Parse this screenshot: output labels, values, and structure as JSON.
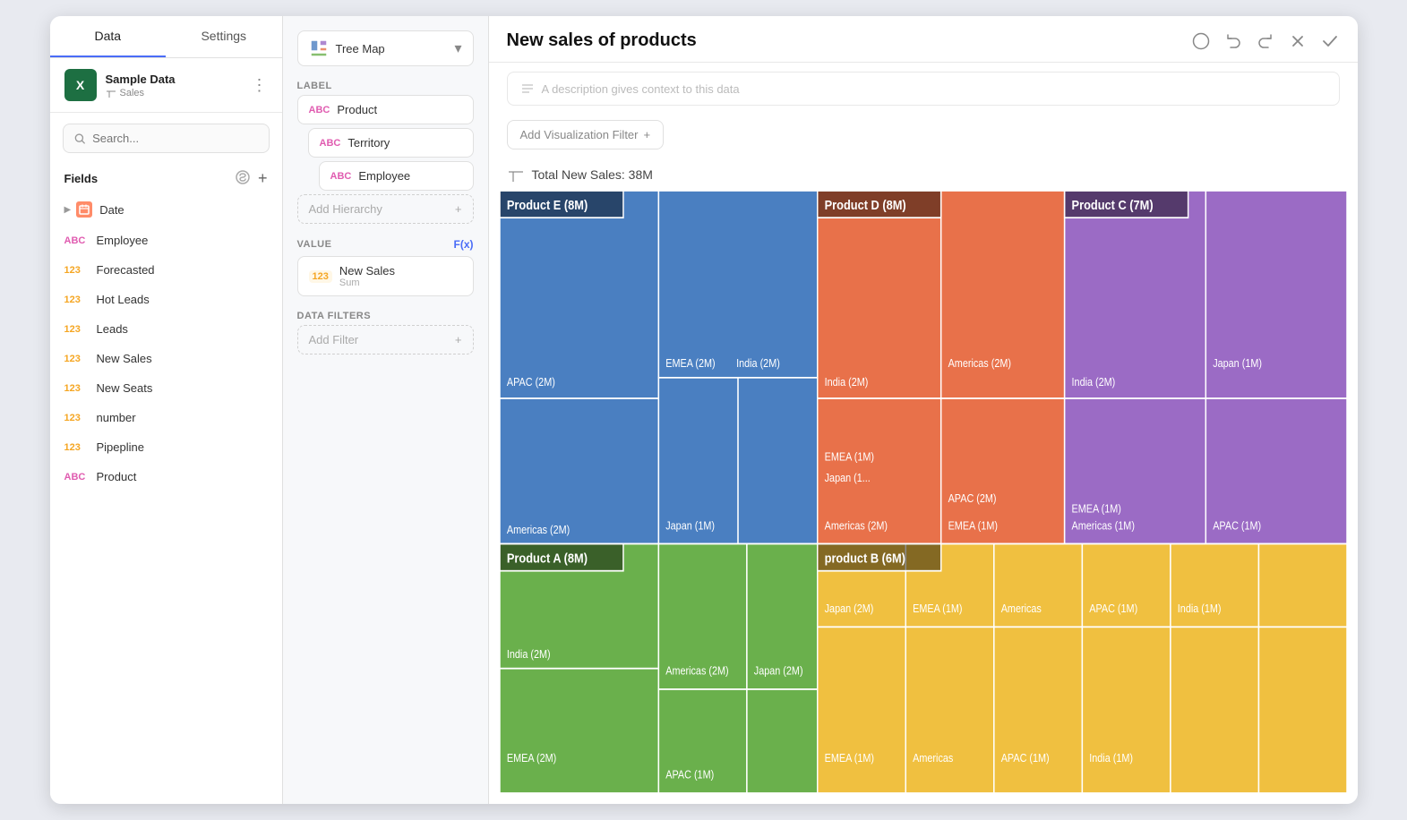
{
  "tabs": [
    {
      "label": "Data",
      "active": true
    },
    {
      "label": "Settings",
      "active": false
    }
  ],
  "datasource": {
    "icon": "X",
    "name": "Sample Data",
    "sub": "Sales"
  },
  "search": {
    "placeholder": "Search..."
  },
  "fields": {
    "label": "Fields",
    "items": [
      {
        "type": "date",
        "name": "Date"
      },
      {
        "type": "abc",
        "name": "Employee"
      },
      {
        "type": "num",
        "name": "Forecasted"
      },
      {
        "type": "num",
        "name": "Hot Leads"
      },
      {
        "type": "num",
        "name": "Leads"
      },
      {
        "type": "num",
        "name": "New Sales"
      },
      {
        "type": "num",
        "name": "New Seats"
      },
      {
        "type": "num",
        "name": "number"
      },
      {
        "type": "num",
        "name": "Pipepline"
      },
      {
        "type": "abc",
        "name": "Product"
      }
    ]
  },
  "chart_type": "Tree Map",
  "label_section": {
    "title": "LABEL",
    "items": [
      {
        "badge": "ABC",
        "name": "Product"
      },
      {
        "badge": "ABC",
        "name": "Territory"
      },
      {
        "badge": "ABC",
        "name": "Employee"
      }
    ],
    "add_label": "Add Hierarchy"
  },
  "value_section": {
    "title": "VALUE",
    "fx": "F(x)",
    "item": {
      "badge": "123",
      "name": "New Sales",
      "sub": "Sum"
    }
  },
  "filter_section": {
    "title": "DATA FILTERS",
    "add_label": "Add Filter"
  },
  "chart": {
    "title": "New sales of products",
    "description_placeholder": "A description gives context to this data",
    "add_filter_label": "Add Visualization Filter",
    "stats": "Total New Sales: 38M"
  },
  "colors": {
    "blue": "#4a7fc1",
    "orange": "#e8714a",
    "purple": "#9b6bc5",
    "green": "#6ab04c",
    "yellow": "#f0c040",
    "dark_label": "rgba(0,0,0,0.55)"
  }
}
